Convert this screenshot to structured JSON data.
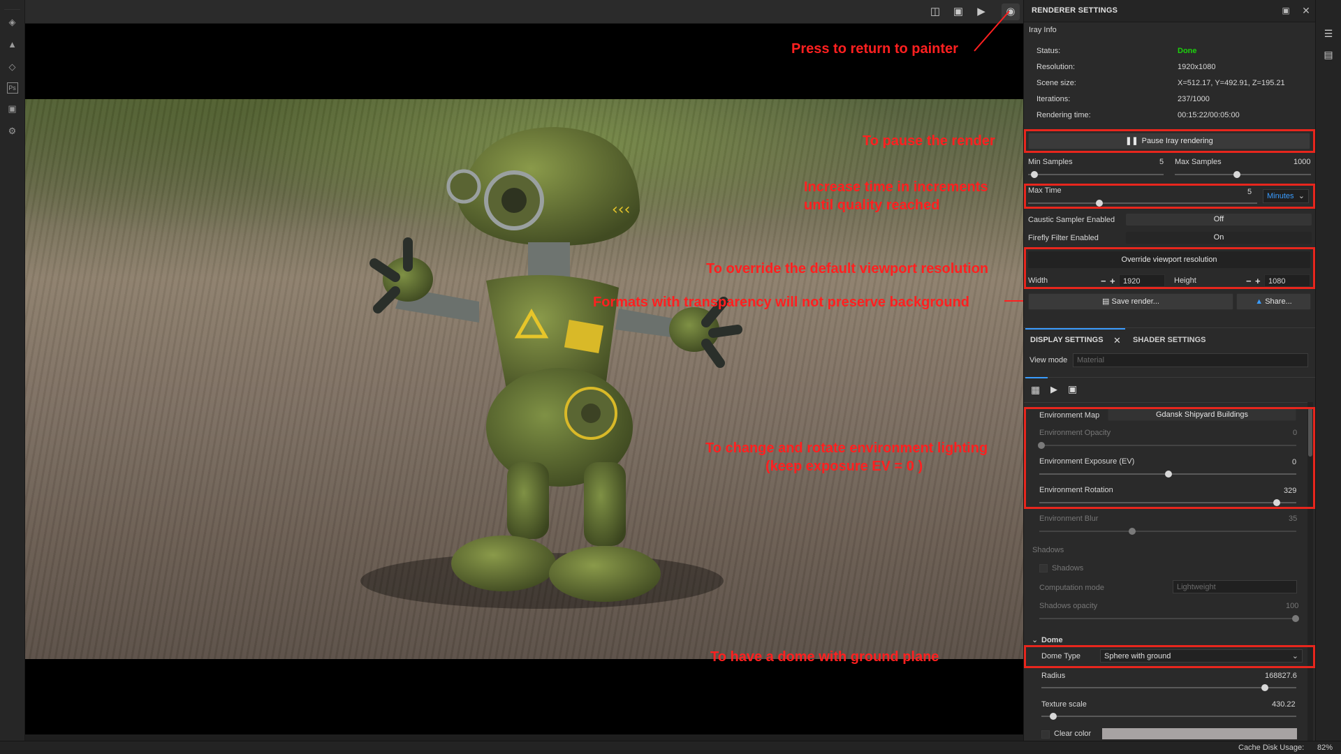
{
  "left_bar": {
    "icons": [
      "layers-icon",
      "bell-icon",
      "stack-icon",
      "photoshop-icon",
      "document-icon",
      "settings-icon"
    ],
    "ps_label": "Ps"
  },
  "viewport": {
    "toolbar_icons": [
      "split-view-icon",
      "cube-icon",
      "camera-icon",
      "screenshot-icon"
    ]
  },
  "callouts": {
    "return": "Press to return to painter",
    "pause": "To pause the render",
    "time_line1": "Increase time in increments",
    "time_line2": "until quality reached",
    "override": "To override the default viewport resolution",
    "formats": "Formats with transparency will not preserve background",
    "env_line1": "To change and rotate environment lighting",
    "env_line2": "(keep exposure EV = 0 )",
    "dome": "To have a dome with ground plane"
  },
  "panel": {
    "title": "RENDERER SETTINGS",
    "section": "Iray Info",
    "info": [
      {
        "label": "Status:",
        "value": "Done"
      },
      {
        "label": "Resolution:",
        "value": "1920x1080"
      },
      {
        "label": "Scene size:",
        "value": "X=512.17, Y=492.91, Z=195.21"
      },
      {
        "label": "Iterations:",
        "value": "237/1000"
      },
      {
        "label": "Rendering time:",
        "value": "00:15:22/00:05:00"
      }
    ],
    "pause_button": "Pause Iray rendering",
    "min_samples": {
      "label": "Min Samples",
      "value": "5"
    },
    "max_samples": {
      "label": "Max Samples",
      "value": "1000"
    },
    "max_time": {
      "label": "Max Time",
      "value": "5",
      "unit": "Minutes"
    },
    "caustic": {
      "label": "Caustic Sampler Enabled",
      "value": "Off"
    },
    "firefly": {
      "label": "Firefly Filter Enabled",
      "value": "On"
    },
    "override_button": "Override viewport resolution",
    "width": {
      "label": "Width",
      "value": "1920"
    },
    "height": {
      "label": "Height",
      "value": "1080"
    },
    "save_button": "Save render...",
    "share_button": "Share...",
    "tabs": {
      "display": "DISPLAY SETTINGS",
      "shader": "SHADER SETTINGS"
    },
    "view_mode": {
      "label": "View mode",
      "placeholder": "Material"
    },
    "env_map": {
      "label": "Environment Map",
      "value": "Gdansk Shipyard Buildings"
    },
    "env_opacity": {
      "label": "Environment Opacity",
      "value": "0"
    },
    "env_exposure": {
      "label": "Environment Exposure (EV)",
      "value": "0"
    },
    "env_rotation": {
      "label": "Environment Rotation",
      "value": "329"
    },
    "env_blur": {
      "label": "Environment Blur",
      "value": "35"
    },
    "shadows_section": "Shadows",
    "shadows_checkbox": "Shadows",
    "computation_mode": {
      "label": "Computation mode",
      "value": "Lightweight"
    },
    "shadows_opacity": {
      "label": "Shadows opacity",
      "value": "100"
    },
    "dome_section": "Dome",
    "dome_type": {
      "label": "Dome Type",
      "value": "Sphere with ground"
    },
    "radius": {
      "label": "Radius",
      "value": "168827.6"
    },
    "texture_scale": {
      "label": "Texture scale",
      "value": "430.22"
    },
    "clear_color": {
      "label": "Clear color"
    }
  },
  "statusbar": {
    "cache_label": "Cache Disk Usage:",
    "cache_value": "82%"
  },
  "colors": {
    "accent_red": "#e8261d",
    "status_green": "#1cd20c",
    "link_blue": "#3a9cff"
  }
}
